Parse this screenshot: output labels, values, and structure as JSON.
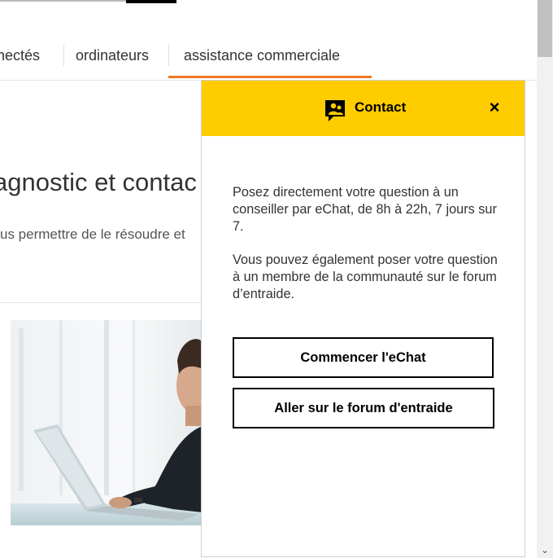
{
  "nav": {
    "tabs": [
      {
        "label": "nectés"
      },
      {
        "label": "ordinateurs"
      },
      {
        "label": "assistance commerciale",
        "active": true
      }
    ],
    "active_color": "#f07722"
  },
  "page": {
    "heading": "agnostic et contac",
    "subtitle": "us permettre de le résoudre et"
  },
  "contact": {
    "title": "Contact",
    "close_label": "×",
    "header_color": "#ffcc00",
    "icon": "chat-agent-icon",
    "paragraph1": "Posez directement votre question à un conseiller par eChat, de 8h à 22h, 7 jours sur 7.",
    "paragraph2": "Vous pouvez également poser votre question à un membre de la communauté sur le forum d’entraide.",
    "echat_button": "Commencer l'eChat",
    "forum_button": "Aller sur le forum d'entraide"
  },
  "scrollbar": {
    "down_arrow": "⌄"
  }
}
